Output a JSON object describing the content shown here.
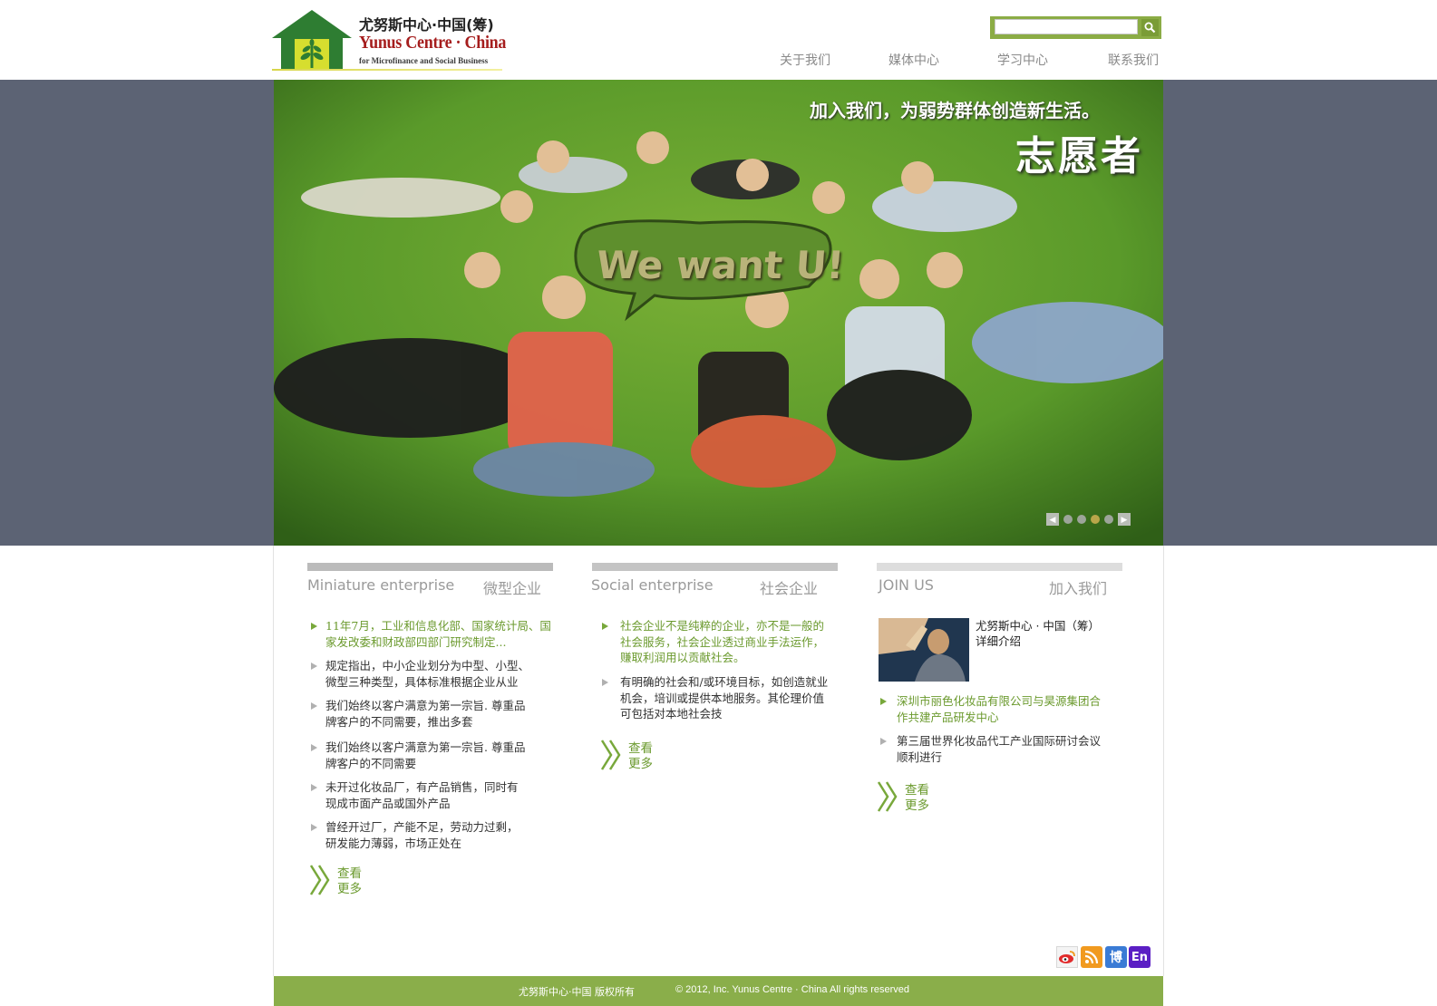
{
  "header": {
    "logo": {
      "cn": "尤努斯中心·中国(筹)",
      "en": "Yunus Centre · China",
      "sub": "for Microfinance and Social Business"
    },
    "search": {
      "placeholder": ""
    },
    "nav": [
      "关于我们",
      "媒体中心",
      "学习中心",
      "联系我们"
    ]
  },
  "banner": {
    "slogan_line1": "加入我们，为弱势群体创造新生活。",
    "slogan_line2": "志愿者",
    "bubble_text": "We want U!",
    "slides": {
      "count": 5,
      "active": 3
    }
  },
  "columns": [
    {
      "title_en": "Miniature enterprise",
      "title_cn": "微型企业",
      "items": [
        {
          "text": "11年7月，工业和信息化部、国家统计局、国家发改委和财政部四部门研究制定...",
          "highlight": true
        },
        {
          "text": "规定指出，中小企业划分为中型、小型、微型三种类型，具体标准根据企业从业",
          "highlight": false
        },
        {
          "text": "我们始终以客户满意为第一宗旨. 尊重品牌客户的不同需要，推出多套",
          "highlight": false
        },
        {
          "text": "我们始终以客户满意为第一宗旨. 尊重品牌客户的不同需要",
          "highlight": false
        },
        {
          "text": "未开过化妆品厂，有产品销售，同时有现成市面产品或国外产品",
          "highlight": false
        },
        {
          "text": "曾经开过厂，产能不足，劳动力过剩，研发能力薄弱，市场正处在",
          "highlight": false
        }
      ],
      "more_line1": "查看",
      "more_line2": "更多"
    },
    {
      "title_en": "Social enterprise",
      "title_cn": "社会企业",
      "items": [
        {
          "text": "社会企业不是纯粹的企业，亦不是一般的社会服务，社会企业透过商业手法运作，赚取利润用以贡献社会。",
          "highlight": true
        },
        {
          "text": "有明确的社会和/或环境目标，如创造就业机会，培训或提供本地服务。其伦理价值可包括对本地社会技",
          "highlight": false
        }
      ],
      "more_line1": "查看",
      "more_line2": "更多"
    },
    {
      "title_en": "JOIN US",
      "title_cn": "加入我们",
      "feature_line1": "尤努斯中心 · 中国（筹）",
      "feature_line2": "详细介绍",
      "items": [
        {
          "text": "深圳市丽色化妆品有限公司与昊源集团合作共建产品研发中心",
          "highlight": true
        },
        {
          "text": "第三届世界化妆品代工产业国际研讨会议顺利进行",
          "highlight": false
        }
      ],
      "more_line1": "查看",
      "more_line2": "更多"
    }
  ],
  "social": [
    {
      "name": "weibo-icon",
      "color": "#e8e8e8"
    },
    {
      "name": "rss-icon",
      "color": "#f19a1f"
    },
    {
      "name": "blog-icon",
      "label": "博",
      "color": "#3a7bd5"
    },
    {
      "name": "english-icon",
      "label": "En",
      "color": "#5b1fc4"
    }
  ],
  "footer": {
    "left": "尤努斯中心·中国 版权所有",
    "right": "© 2012, Inc. Yunus Centre · China   All rights reserved"
  },
  "colors": {
    "brand_green": "#8aae4a",
    "link_green": "#6b9a2e",
    "banner_bg": "#5c6374"
  }
}
